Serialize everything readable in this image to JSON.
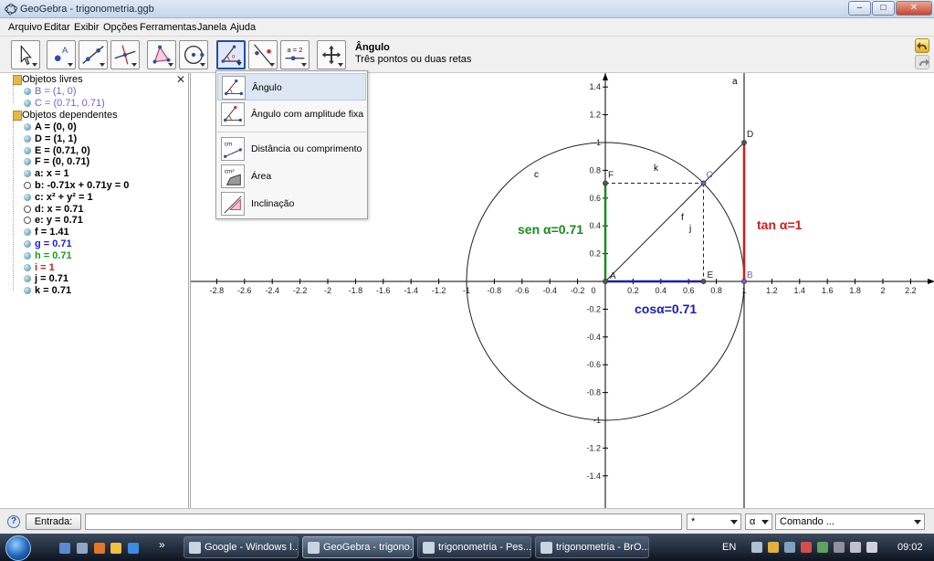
{
  "window": {
    "title": "GeoGebra - trigonometria.ggb",
    "minimize": "–",
    "maximize": "□",
    "close": "✕"
  },
  "menu": [
    "Arquivo",
    "Editar",
    "Exibir",
    "Opções",
    "Ferramentas",
    "Janela",
    "Ajuda"
  ],
  "toolbar": {
    "active_title": "Ângulo",
    "active_desc": "Três pontos ou duas retas",
    "tools": [
      "move-tool-icon",
      "point-tool-icon",
      "line-tool-icon",
      "perpendicular-tool-icon",
      "polygon-tool-icon",
      "circle-tool-icon",
      "angle-tool-icon",
      "reflect-tool-icon",
      "slider-tool-icon",
      "move-view-tool-icon"
    ],
    "slider_glyph": "a = 2"
  },
  "dropdown": {
    "items": [
      {
        "label": "Ângulo",
        "icon": "angle-icon"
      },
      {
        "label": "Ângulo com amplitude fixa",
        "icon": "fixed-angle-icon"
      },
      {
        "label": "Distância ou comprimento",
        "icon": "distance-icon"
      },
      {
        "label": "Área",
        "icon": "area-icon"
      },
      {
        "label": "Inclinação",
        "icon": "slope-icon"
      }
    ],
    "cm_glyph": "cm",
    "cm2_glyph": "cm²"
  },
  "algebra": {
    "close": "✕",
    "free_header": "Objetos livres",
    "free": [
      {
        "text": "B = (1, 0)",
        "color": "#6c63c9"
      },
      {
        "text": "C = (0.71, 0.71)",
        "color": "#6c63c9"
      }
    ],
    "dependent_header": "Objetos dependentes",
    "dependent": [
      {
        "text": "A = (0, 0)",
        "color": "#000000",
        "hollow": false
      },
      {
        "text": "D = (1, 1)",
        "color": "#000000",
        "hollow": false
      },
      {
        "text": "E = (0.71, 0)",
        "color": "#000000",
        "hollow": false
      },
      {
        "text": "F = (0, 0.71)",
        "color": "#000000",
        "hollow": false
      },
      {
        "text": "a: x = 1",
        "color": "#000000",
        "hollow": false
      },
      {
        "text": "b: -0.71x + 0.71y = 0",
        "color": "#000000",
        "hollow": true
      },
      {
        "text": "c: x² + y² = 1",
        "color": "#000000",
        "hollow": false
      },
      {
        "text": "d: x = 0.71",
        "color": "#000000",
        "hollow": true
      },
      {
        "text": "e: y = 0.71",
        "color": "#000000",
        "hollow": true
      },
      {
        "text": "f = 1.41",
        "color": "#000000",
        "hollow": false
      },
      {
        "text": "g = 0.71",
        "color": "#1c1cd0",
        "hollow": false
      },
      {
        "text": "h = 0.71",
        "color": "#1a9b1a",
        "hollow": false
      },
      {
        "text": "i = 1",
        "color": "#d01c1c",
        "hollow": false
      },
      {
        "text": "j = 0.71",
        "color": "#000000",
        "hollow": false
      },
      {
        "text": "k = 0.71",
        "color": "#000000",
        "hollow": false
      }
    ]
  },
  "graphics": {
    "x_ticks": [
      "-2.8",
      "-2.6",
      "-2.4",
      "-2.2",
      "-2",
      "-1.8",
      "-1.6",
      "-1.4",
      "-1.2",
      "-1",
      "-0.8",
      "-0.6",
      "-0.4",
      "-0.2",
      "0",
      "0.2",
      "0.4",
      "0.6",
      "0.8",
      "1",
      "1.2",
      "1.4",
      "1.6",
      "1.8",
      "2",
      "2.2"
    ],
    "y_ticks": [
      "1.4",
      "1.2",
      "1",
      "0.8",
      "0.6",
      "0.4",
      "0.2",
      "0",
      "-0.2",
      "-0.4",
      "-0.6",
      "-0.8",
      "-1",
      "-1.2",
      "-1.4"
    ],
    "labels": {
      "sen": "sen α=0.71",
      "cos": "cosα=0.71",
      "tan": "tan α=1",
      "A": "A",
      "B": "B",
      "C": "C",
      "D": "D",
      "E": "E",
      "F": "F",
      "a": "a",
      "c": "c",
      "f": "f",
      "j": "j",
      "k": "k"
    },
    "colors": {
      "sen": "#1a8a1a",
      "cos": "#1c1cb8",
      "tan": "#d01c1c"
    }
  },
  "inputbar": {
    "help": "?",
    "entrada_label": "Entrada:",
    "symbol_combo": "*",
    "greek_combo": "α",
    "command_combo": "Comando ..."
  },
  "taskbar": {
    "tasks": [
      "Google - Windows I...",
      "GeoGebra - trigono...",
      "trigonometria - Pes...",
      "trigonometria - BrO..."
    ],
    "overflow": "»",
    "lang": "EN",
    "time": "09:02"
  }
}
